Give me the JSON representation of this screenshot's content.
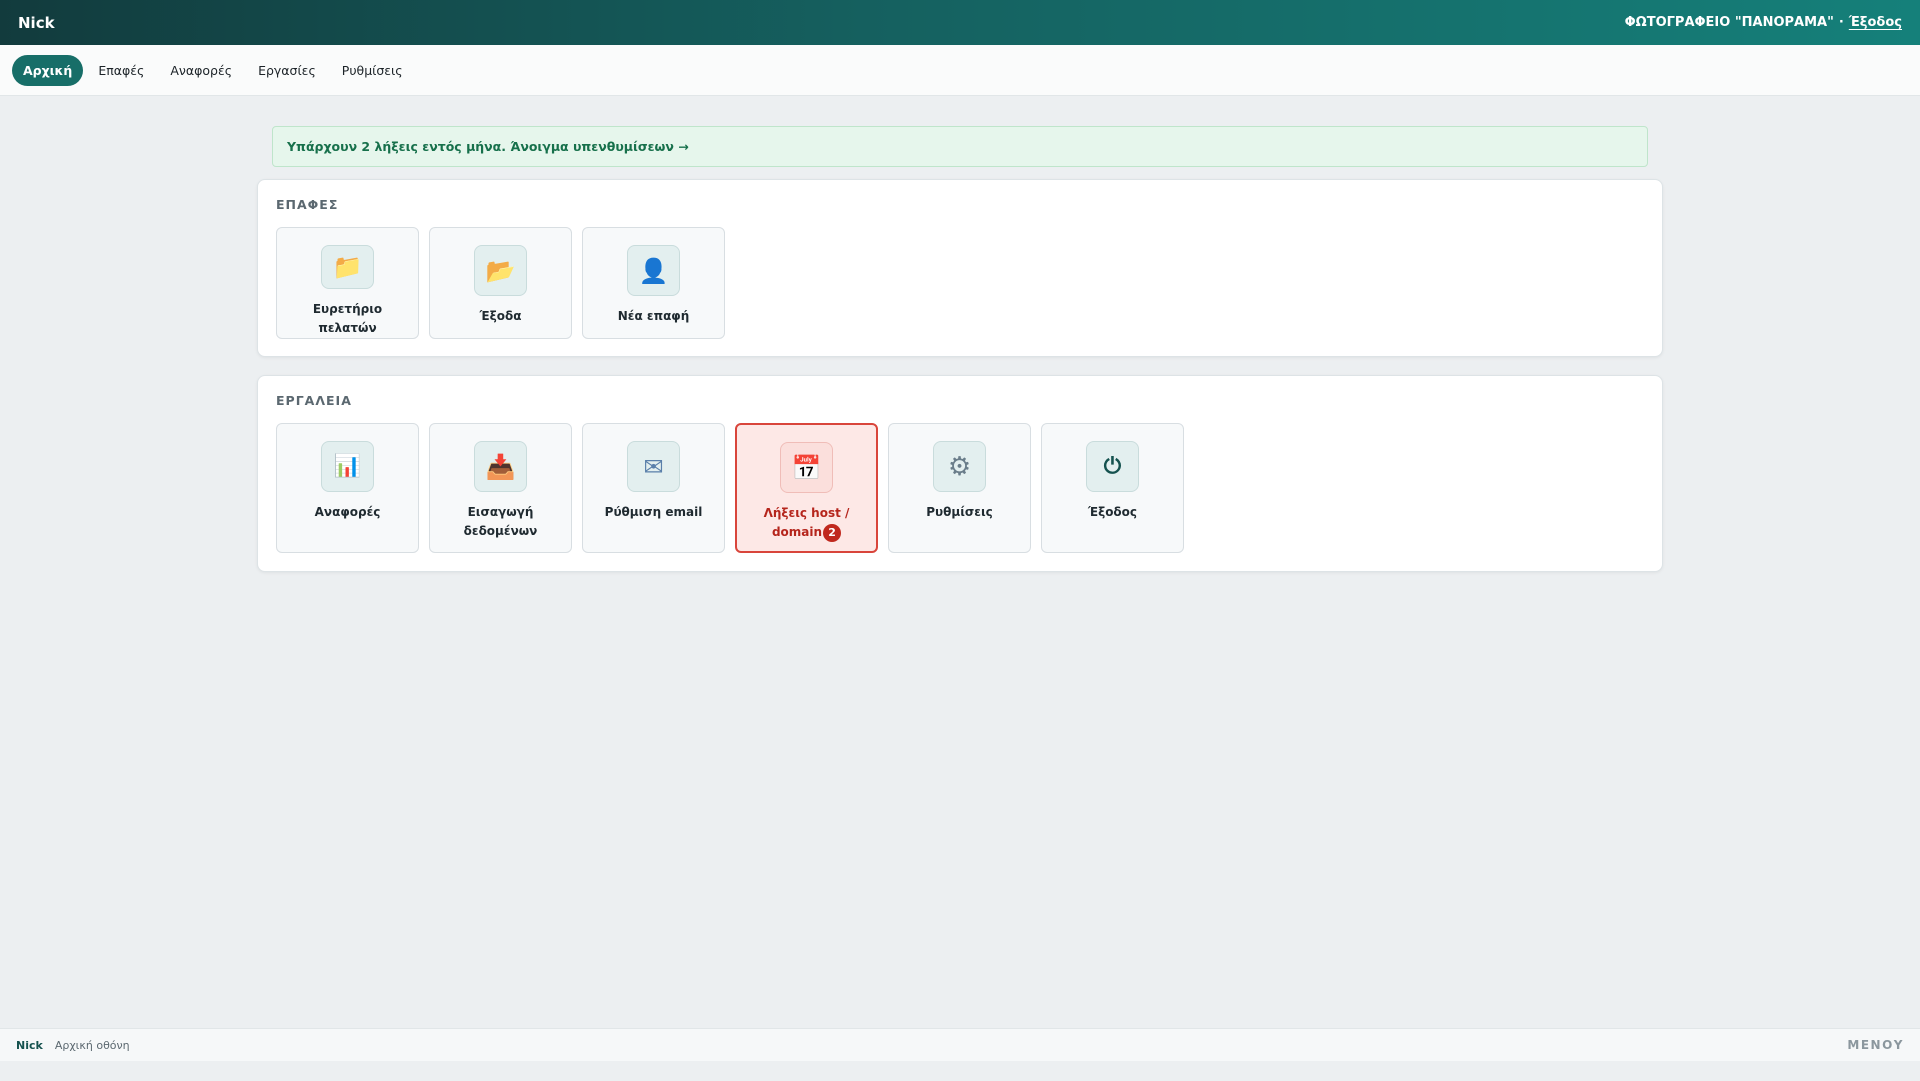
{
  "header": {
    "brand": "Nick",
    "company": "ΦΩΤΟΓΡΑΦΕΙΟ \"ΠΑΝΟΡΑΜΑ\"",
    "separator": "·",
    "logout": "Έξοδος"
  },
  "nav": {
    "items": [
      {
        "label": "Αρχική",
        "active": true
      },
      {
        "label": "Επαφές",
        "active": false
      },
      {
        "label": "Αναφορές",
        "active": false
      },
      {
        "label": "Εργασίες",
        "active": false
      },
      {
        "label": "Ρυθμίσεις",
        "active": false
      }
    ]
  },
  "alert": {
    "text": "Υπάρχουν 2 λήξεις εντός μήνα. Άνοιγμα υπενθυμίσεων →",
    "color": "#17704b"
  },
  "contacts": {
    "title": "ΕΠΑΦΕΣ",
    "tiles": [
      {
        "label": "Ευρετήριο πελατών",
        "icon": "folder-icon",
        "glyph": "📁"
      },
      {
        "label": "Έξοδα",
        "icon": "folder-open-icon",
        "glyph": "📂"
      },
      {
        "label": "Νέα επαφή",
        "icon": "user-icon",
        "glyph": "👤"
      }
    ]
  },
  "tools": {
    "title": "ΕΡΓΑΛΕΙΑ",
    "tiles": [
      {
        "label": "Αναφορές",
        "icon": "bar-chart-icon",
        "glyph": "📊"
      },
      {
        "label": "Εισαγωγή δεδομένων",
        "icon": "inbox-tray-icon",
        "glyph": "📥"
      },
      {
        "label": "Ρύθμιση email",
        "icon": "envelope-icon",
        "glyph": "✉"
      },
      {
        "label": "Λήξεις host / domain",
        "icon": "calendar-icon",
        "glyph": "📅",
        "badge": "2",
        "highlight_color": "#d9453b"
      },
      {
        "label": "Ρυθμίσεις",
        "icon": "gear-icon",
        "glyph": "⚙"
      },
      {
        "label": "Έξοδος",
        "icon": "power-icon",
        "glyph": "⏻"
      }
    ]
  },
  "footer": {
    "user": "Nick",
    "screen": "Αρχική οθόνη",
    "menu": "ΜΕΝΟΥ"
  },
  "colors": {
    "accent": "#176e68",
    "header_gradient_start": "#123b3d",
    "header_gradient_end": "#15807a",
    "alert_bg": "#e6f6ec",
    "danger": "#c0281e"
  }
}
